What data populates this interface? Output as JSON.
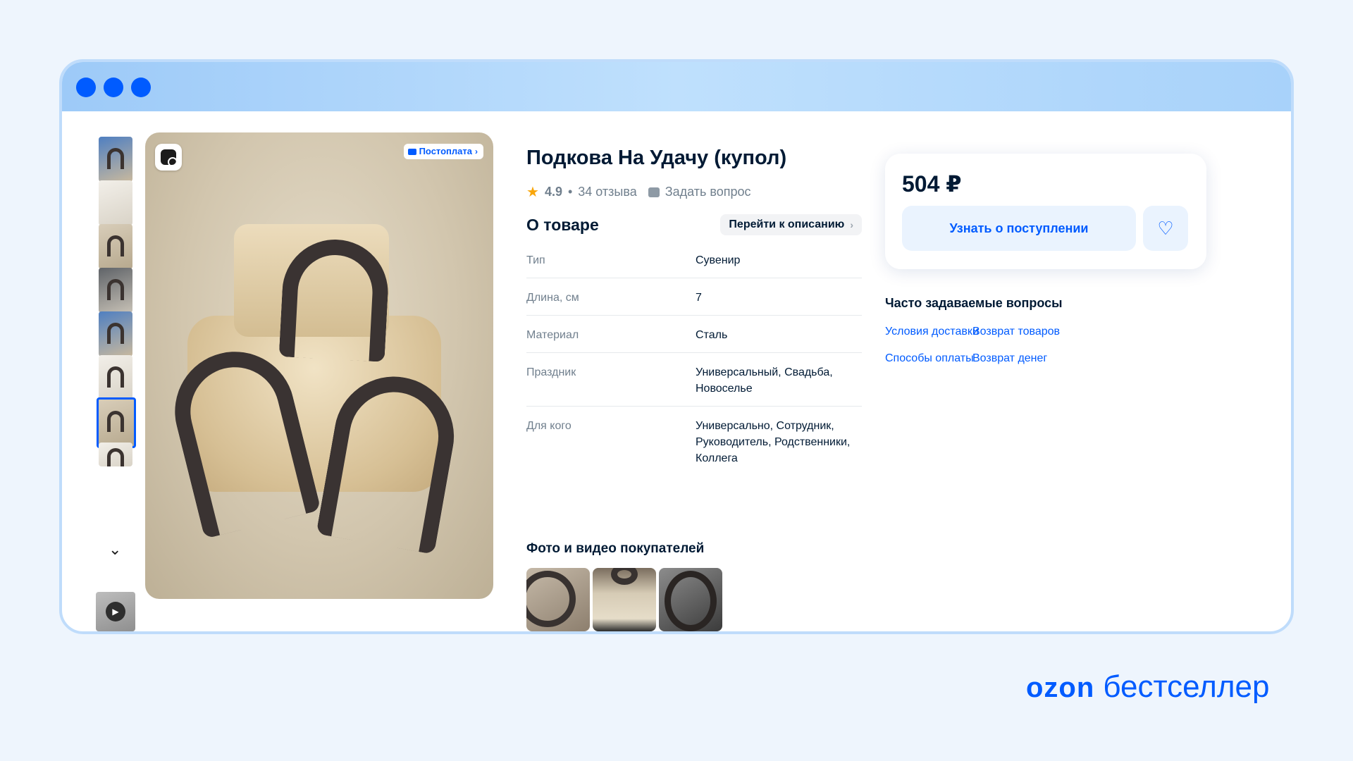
{
  "window": {
    "controls": [
      "dot",
      "dot",
      "dot"
    ]
  },
  "gallery": {
    "badge": "Постоплата",
    "thumb_count": 8,
    "active_thumb": 7
  },
  "product": {
    "title": "Подкова На Удачу (купол)",
    "rating": "4.9",
    "separator": "•",
    "reviews": "34 отзыва",
    "ask_question": "Задать вопрос",
    "about_title": "О товаре",
    "go_to_description": "Перейти к описанию",
    "specs": [
      {
        "key": "Тип",
        "value": "Сувенир"
      },
      {
        "key": "Длина, см",
        "value": "7"
      },
      {
        "key": "Материал",
        "value": "Сталь"
      },
      {
        "key": "Праздник",
        "value": "Универсальный, Свадьба, Новоселье"
      },
      {
        "key": "Для кого",
        "value": "Универсально, Сотрудник, Руководитель, Родственники, Коллега"
      }
    ],
    "buyer_media_title": "Фото и видео покупателей"
  },
  "buy": {
    "price": "504 ₽",
    "notify_label": "Узнать о поступлении"
  },
  "faq": {
    "title": "Часто задаваемые вопросы",
    "links": [
      "Условия доставки",
      "Возврат товаров",
      "Способы оплаты",
      "Возврат денег"
    ]
  },
  "brand": {
    "logo": "ozon",
    "tagline": "бестселлер"
  },
  "colors": {
    "accent": "#005bff",
    "background": "#eef5fd",
    "star": "#f9a60b"
  }
}
